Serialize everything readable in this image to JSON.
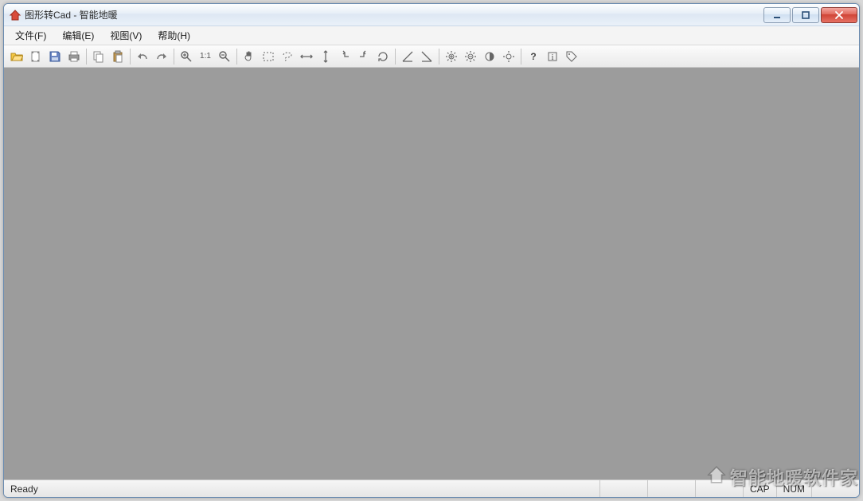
{
  "window": {
    "title": "图形转Cad - 智能地暖"
  },
  "menu": {
    "file": "文件(F)",
    "edit": "编辑(E)",
    "view": "视图(V)",
    "help": "帮助(H)"
  },
  "toolbar": {
    "open": "open",
    "new": "new",
    "save": "save",
    "print": "print",
    "copy": "copy",
    "paste": "paste",
    "undo": "undo",
    "redo": "redo",
    "zoom_in": "zoom-in",
    "one_to_one": "1:1",
    "zoom_out": "zoom-out",
    "pan": "pan",
    "select_rect": "select-rect",
    "select_lasso": "select-lasso",
    "arrow_h": "arrow-h",
    "arrow_v": "arrow-v",
    "arrow_left": "arrow-left",
    "arrow_right": "arrow-right",
    "refresh": "refresh",
    "angle1": "angle-left",
    "angle2": "angle-right",
    "bright_up": "bright-up",
    "bright_down": "bright-down",
    "contrast": "contrast",
    "reset_light": "reset-light",
    "help": "?",
    "info": "i",
    "tag": "tag"
  },
  "status": {
    "ready": "Ready",
    "cap": "CAP",
    "num": "NUM"
  },
  "watermark": {
    "text": "智能地暖软件家"
  }
}
